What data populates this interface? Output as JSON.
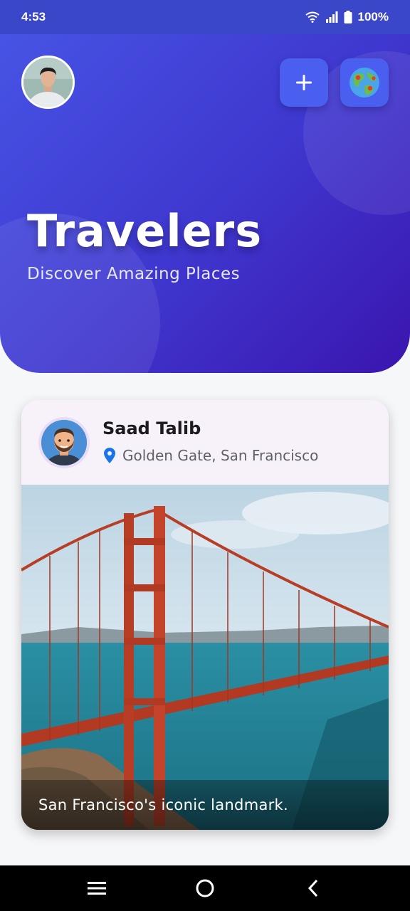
{
  "status_bar": {
    "time": "4:53",
    "battery": "100%"
  },
  "header": {
    "title": "Travelers",
    "subtitle": "Discover Amazing Places",
    "add_icon": "plus-icon",
    "map_icon": "globe-map-icon"
  },
  "post": {
    "author": "Saad Talib",
    "location": "Golden Gate, San Francisco",
    "caption": "San Francisco's iconic landmark.",
    "location_icon": "location-pin-icon"
  },
  "colors": {
    "hero_gradient_start": "#4756e6",
    "hero_gradient_end": "#3a15ae",
    "button": "#4a5ff0",
    "pin": "#1a73e8"
  },
  "nav_bar": {
    "items": [
      "menu-icon",
      "home-circle-icon",
      "back-chevron-icon"
    ]
  }
}
